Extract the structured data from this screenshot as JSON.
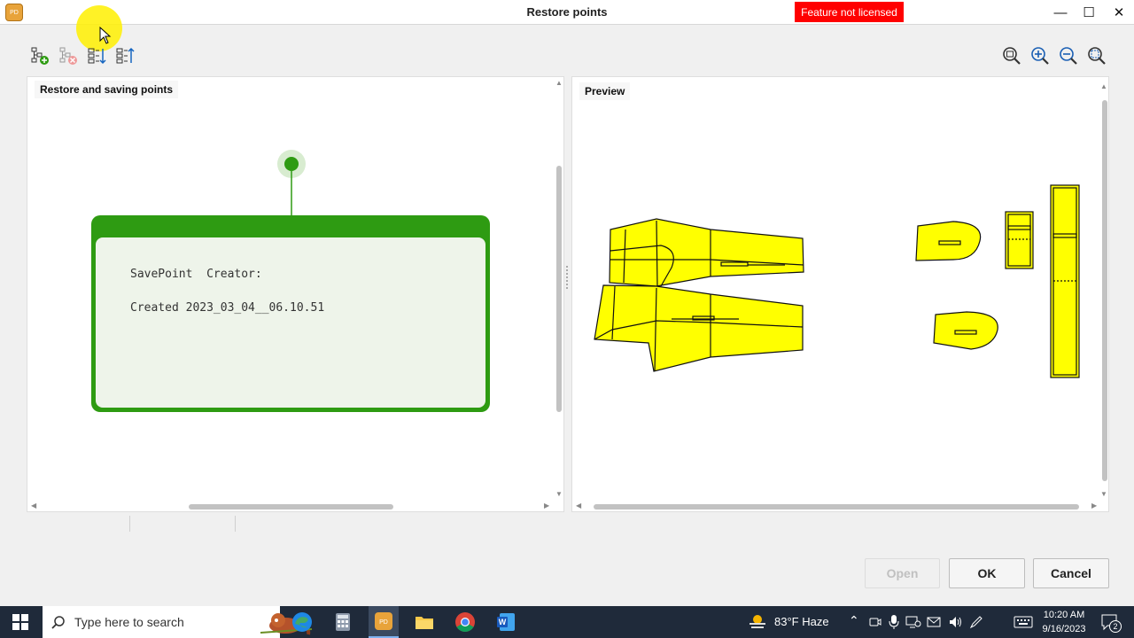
{
  "window": {
    "title": "Restore points",
    "license_badge": "Feature not licensed",
    "app_icon_text": "PD",
    "controls": {
      "minimize": "—",
      "maximize": "☐",
      "close": "✕"
    }
  },
  "toolbar": {
    "left_icons": [
      "add-savepoint-icon",
      "delete-savepoint-icon",
      "expand-tree-icon",
      "collapse-tree-icon"
    ],
    "right_icons": [
      "zoom-fit-icon",
      "zoom-in-icon",
      "zoom-out-icon",
      "zoom-area-icon"
    ]
  },
  "left_panel": {
    "label": "Restore and saving points",
    "card": {
      "creator_line": "SavePoint  Creator:",
      "created_line": "Created 2023_03_04__06.10.51"
    },
    "colors": {
      "node": "#2e9b12",
      "card_border": "#2e9b12",
      "card_fill": "#eef4ea"
    }
  },
  "right_panel": {
    "label": "Preview",
    "pattern_fill": "#ffff00"
  },
  "buttons": {
    "open": "Open",
    "ok": "OK",
    "cancel": "Cancel"
  },
  "taskbar": {
    "search_placeholder": "Type here to search",
    "apps": [
      "windows-start-icon",
      "edge-icon",
      "calculator-icon",
      "pd-app-icon",
      "file-explorer-icon",
      "chrome-icon",
      "word-icon"
    ],
    "weather": "83°F  Haze",
    "time": "10:20 AM",
    "date": "9/16/2023",
    "notification_count": "2"
  }
}
